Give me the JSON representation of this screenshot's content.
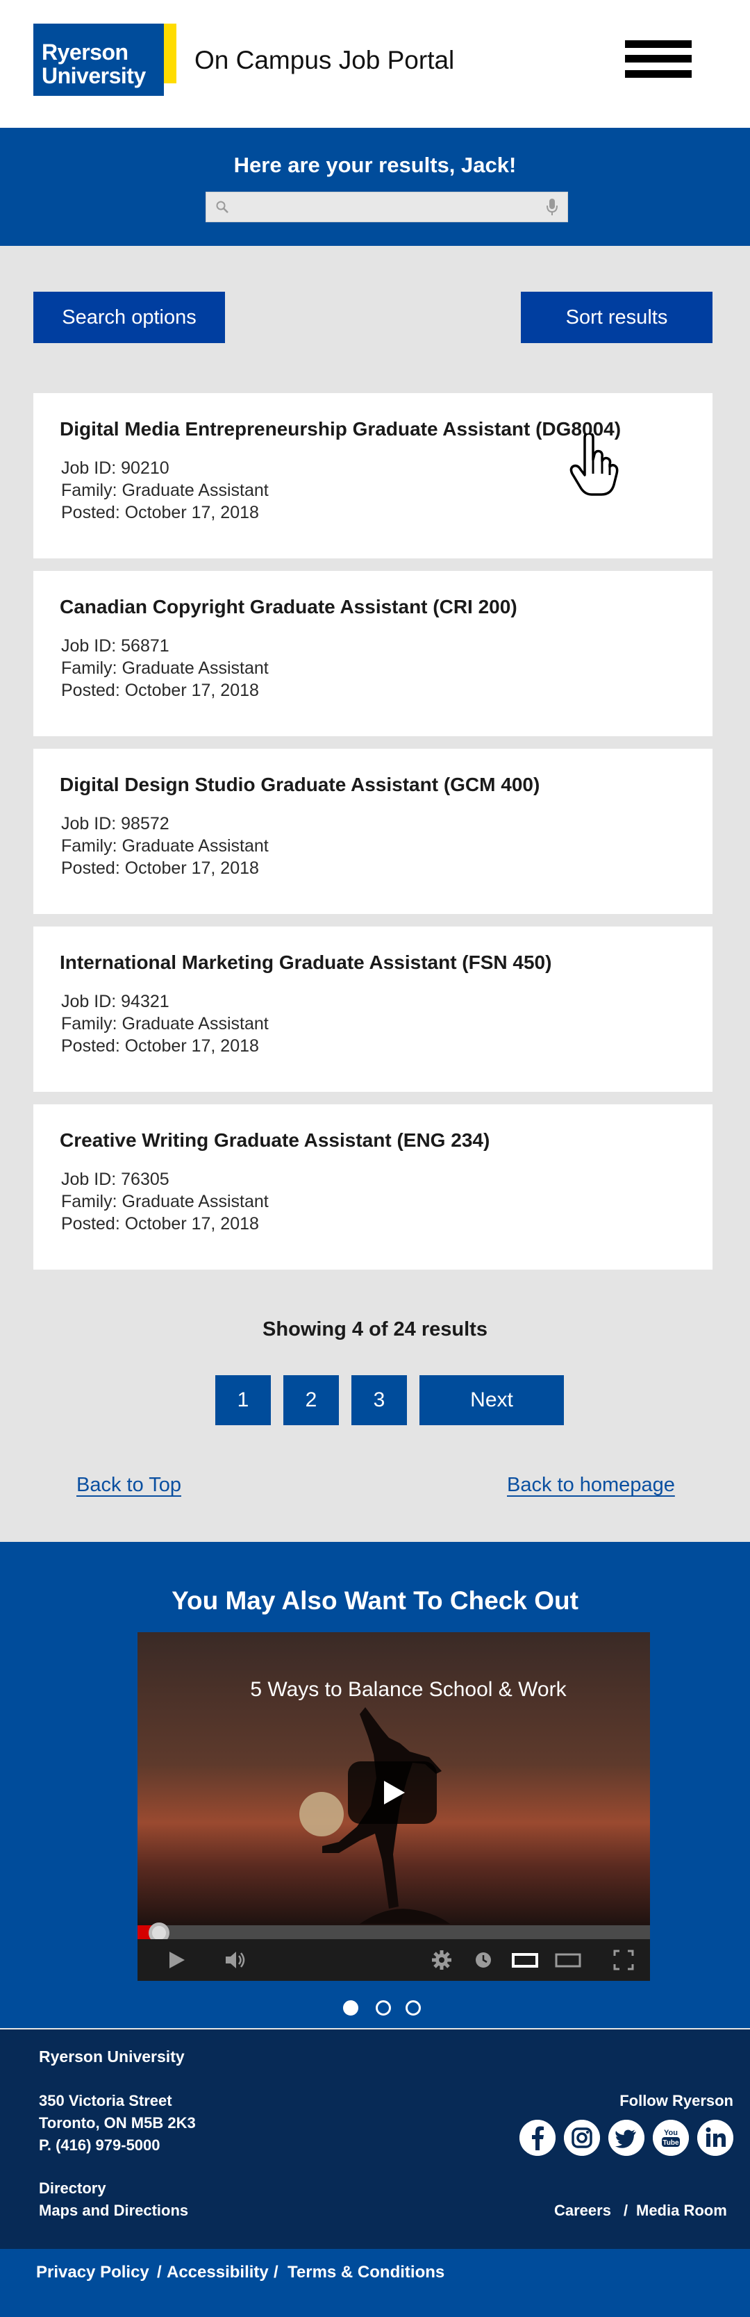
{
  "header": {
    "logo_line1": "Ryerson",
    "logo_line2": "University",
    "portal_title": "On Campus Job Portal",
    "menu_icon": "hamburger-menu-icon"
  },
  "banner": {
    "greeting": "Here are your results, Jack!",
    "search_value": "",
    "search_placeholder": "",
    "search_icon": "search-icon",
    "mic_icon": "microphone-icon"
  },
  "actions": {
    "search_options": "Search options",
    "sort_results": "Sort results"
  },
  "jobs": [
    {
      "title": "Digital Media Entrepreneurship Graduate Assistant (DG8004)",
      "job_id": "Job ID: 90210",
      "family": "Family: Graduate Assistant",
      "posted": "Posted: October 17, 2018"
    },
    {
      "title": "Canadian Copyright Graduate Assistant (CRI 200)",
      "job_id": "Job ID: 56871",
      "family": "Family: Graduate Assistant",
      "posted": "Posted: October 17, 2018"
    },
    {
      "title": "Digital Design Studio Graduate Assistant (GCM 400)",
      "job_id": "Job ID: 98572",
      "family": "Family: Graduate Assistant",
      "posted": "Posted: October 17, 2018"
    },
    {
      "title": "International Marketing Graduate Assistant (FSN 450)",
      "job_id": "Job ID: 94321",
      "family": "Family: Graduate Assistant",
      "posted": "Posted: October 17, 2018"
    },
    {
      "title": "Creative Writing Graduate Assistant (ENG 234)",
      "job_id": "Job ID: 76305",
      "family": "Family: Graduate Assistant",
      "posted": "Posted: October 17, 2018"
    }
  ],
  "pagination": {
    "showing": "Showing 4 of 24 results",
    "pages": [
      "1",
      "2",
      "3"
    ],
    "next": "Next"
  },
  "links": {
    "back_to_top": "Back to Top",
    "back_to_homepage": "Back to homepage"
  },
  "also": {
    "title": "You May Also Want To Check Out",
    "video_title": "5 Ways to Balance School & Work",
    "video_progress": 0.03,
    "carousel_active": 1,
    "carousel_count": 3
  },
  "footer": {
    "org": "Ryerson University",
    "address1": "350 Victoria Street",
    "address2": "Toronto, ON M5B 2K3",
    "phone": "P. (416) 979-5000",
    "directory": "Directory",
    "maps": "Maps and Directions",
    "follow": "Follow Ryerson",
    "social_icons": [
      "facebook-icon",
      "instagram-icon",
      "twitter-icon",
      "youtube-icon",
      "linkedin-icon"
    ],
    "careers": "Careers",
    "separator": "/",
    "media_room": "Media Room",
    "privacy": "Privacy Policy",
    "accessibility": "Accessibility",
    "terms": "Terms & Conditions"
  },
  "colors": {
    "brand_blue": "#004c9b",
    "button_blue": "#003ea0",
    "footer_navy": "#072a56",
    "logo_yellow": "#ffdc00"
  }
}
